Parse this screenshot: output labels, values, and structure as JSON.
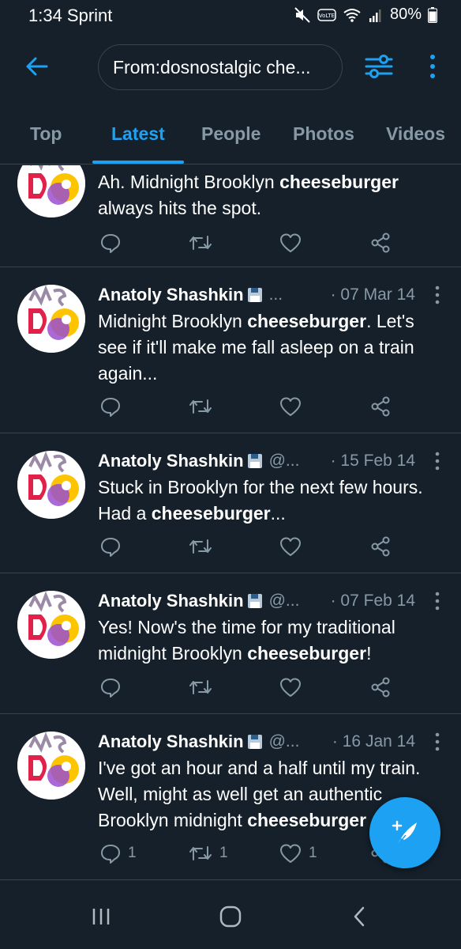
{
  "status_bar": {
    "time": "1:34 Sprint",
    "battery": "80%",
    "volte_label": "VoLTE"
  },
  "header": {
    "search_query": "From:dosnostalgic che..."
  },
  "tabs": [
    {
      "label": "Top"
    },
    {
      "label": "Latest"
    },
    {
      "label": "People"
    },
    {
      "label": "Photos"
    },
    {
      "label": "Videos"
    }
  ],
  "active_tab": "Latest",
  "colors": {
    "background": "#15202b",
    "accent": "#1da1f2",
    "secondary_text": "#8899a6",
    "divider": "#38444d"
  },
  "tweets": [
    {
      "name": "",
      "handle": "",
      "date": "",
      "text_parts": [
        "Ah. Midnight Brooklyn ",
        "cheeseburger",
        " always hits the spot."
      ],
      "replies": "",
      "retweets": "",
      "likes": ""
    },
    {
      "name": "Anatoly Shashkin",
      "handle": "...",
      "date": "· 07 Mar 14",
      "text_parts": [
        "Midnight Brooklyn ",
        "cheeseburger",
        ". Let's see if it'll make me fall asleep on a train again..."
      ],
      "replies": "",
      "retweets": "",
      "likes": ""
    },
    {
      "name": "Anatoly Shashkin",
      "handle": "@...",
      "date": "· 15 Feb 14",
      "text_parts": [
        "Stuck in Brooklyn for the next few hours. Had a ",
        "cheeseburger",
        "..."
      ],
      "replies": "",
      "retweets": "",
      "likes": ""
    },
    {
      "name": "Anatoly Shashkin",
      "handle": "@...",
      "date": "· 07 Feb 14",
      "text_parts": [
        "Yes! Now's the time for my traditional midnight Brooklyn ",
        "cheeseburger",
        "!"
      ],
      "replies": "",
      "retweets": "",
      "likes": ""
    },
    {
      "name": "Anatoly Shashkin",
      "handle": "@...",
      "date": "· 16 Jan 14",
      "text_parts": [
        "I've got an hour and a half until my train. Well, might as well get an authentic Brooklyn midnight ",
        "cheeseburger",
        ""
      ],
      "replies": "1",
      "retweets": "1",
      "likes": "1"
    }
  ]
}
